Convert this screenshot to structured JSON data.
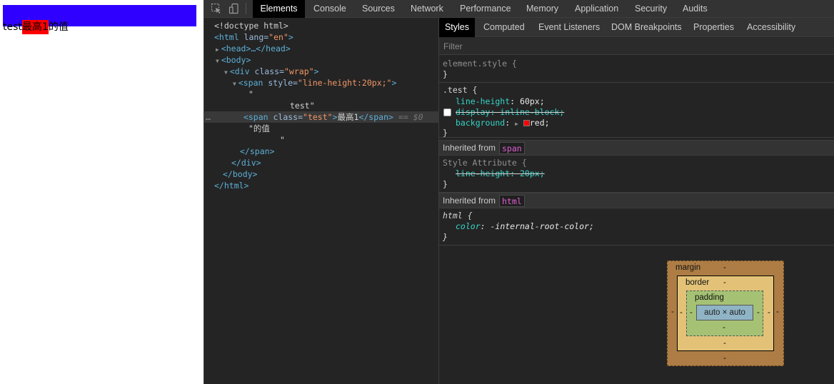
{
  "page": {
    "text_before": "test",
    "highlight": "最高1",
    "text_after": "的值"
  },
  "toolbar": {
    "tabs": [
      "Elements",
      "Console",
      "Sources",
      "Network",
      "Performance",
      "Memory",
      "Application",
      "Security",
      "Audits"
    ],
    "active_tab": "Elements"
  },
  "dom": {
    "doctype": "<!doctype html>",
    "html_open": "<html",
    "html_attr": " lang=",
    "html_val": "\"en\"",
    "head": "<head>…</head>",
    "body_open": "<body>",
    "div_open": "<div",
    "div_attr": " class=",
    "div_val": "\"wrap\"",
    "span_open": "<span",
    "span_attr": " style=",
    "span_val": "\"line-height:20px;\"",
    "quote1": "\"",
    "text_test": "test\"",
    "sel_ellipsis": "…",
    "sel_open": "<span",
    "sel_attr": " class=",
    "sel_val": "\"test\"",
    "sel_close_bracket": ">",
    "sel_text": "最高1",
    "sel_end": "</span>",
    "sel_marker": "== $0",
    "text_de": "\"的值",
    "quote2": "\"",
    "span_close": "</span>",
    "div_close": "</div>",
    "body_close": "</body>",
    "html_close": "</html>"
  },
  "styles": {
    "subtabs": [
      "Styles",
      "Computed",
      "Event Listeners",
      "DOM Breakpoints",
      "Properties",
      "Accessibility"
    ],
    "active_subtab": "Styles",
    "filter_placeholder": "Filter",
    "element_style": "element.style {",
    "close_brace": "}",
    "test_selector": ".test {",
    "test_lh_prop": "line-height",
    "test_lh_val": ": 60px;",
    "test_display": "display: inline-block;",
    "test_bg_prop": "background",
    "test_bg_val": "red;",
    "inherited_label": "Inherited from",
    "inherited_span": "span",
    "style_attr": "Style Attribute {",
    "style_attr_prop": "line-height: 20px;",
    "inherited_html": "html",
    "html_selector": "html {",
    "html_prop": "color",
    "html_val": ": -internal-root-color;"
  },
  "box_model": {
    "margin_label": "margin",
    "border_label": "border",
    "padding_label": "padding",
    "content": "auto × auto",
    "dash": "-"
  },
  "colors": {
    "preview_bar": "#2f00ff",
    "highlight_bg": "#ff0000"
  }
}
